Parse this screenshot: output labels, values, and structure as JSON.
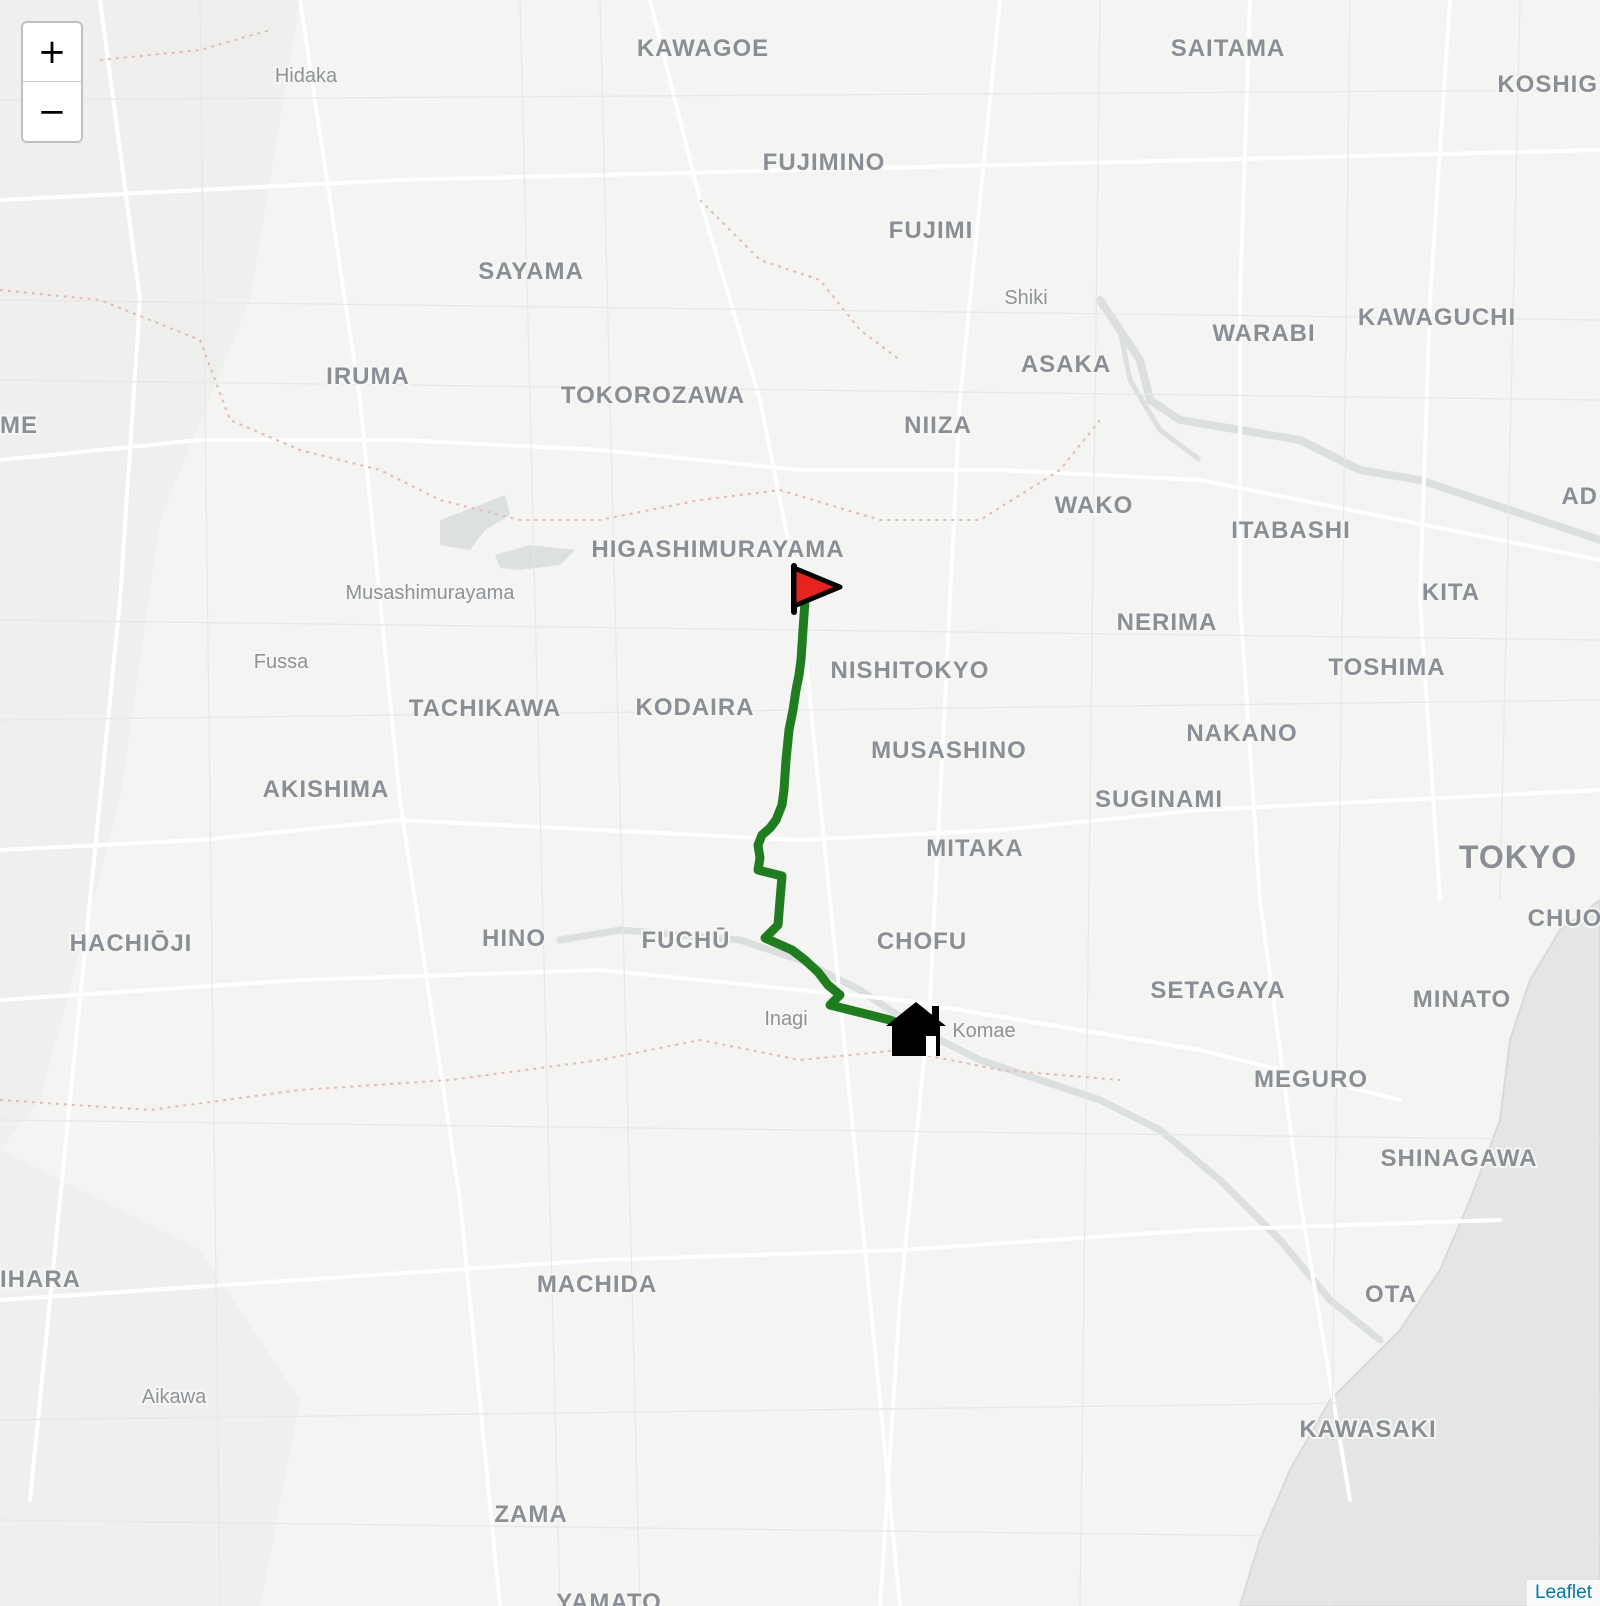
{
  "map": {
    "zoom_in_label": "+",
    "zoom_out_label": "−",
    "attribution": "Leaflet",
    "route_color": "#1f7d1f",
    "start_marker": {
      "icon": "flag-icon",
      "color": "#e8231f"
    },
    "end_marker": {
      "icon": "home-icon",
      "color": "#000000"
    },
    "labels": [
      {
        "text": "KAWAGOE",
        "kind": "city"
      },
      {
        "text": "SAITAMA",
        "kind": "city"
      },
      {
        "text": "KOSHIG",
        "kind": "city"
      },
      {
        "text": "Hidaka",
        "kind": "town"
      },
      {
        "text": "FUJIMINO",
        "kind": "city"
      },
      {
        "text": "FUJIMI",
        "kind": "city"
      },
      {
        "text": "SAYAMA",
        "kind": "city"
      },
      {
        "text": "Shiki",
        "kind": "town"
      },
      {
        "text": "WARABI",
        "kind": "city"
      },
      {
        "text": "KAWAGUCHI",
        "kind": "city"
      },
      {
        "text": "ASAKA",
        "kind": "city"
      },
      {
        "text": "IRUMA",
        "kind": "city"
      },
      {
        "text": "TOKOROZAWA",
        "kind": "city"
      },
      {
        "text": "NIIZA",
        "kind": "city"
      },
      {
        "text": "ME",
        "kind": "city"
      },
      {
        "text": "WAKO",
        "kind": "city"
      },
      {
        "text": "ITABASHI",
        "kind": "city"
      },
      {
        "text": "AD",
        "kind": "city"
      },
      {
        "text": "HIGASHIMURAYAMA",
        "kind": "city"
      },
      {
        "text": "Musashimurayama",
        "kind": "town"
      },
      {
        "text": "KITA",
        "kind": "city"
      },
      {
        "text": "NERIMA",
        "kind": "city"
      },
      {
        "text": "Fussa",
        "kind": "town"
      },
      {
        "text": "NISHITOKYO",
        "kind": "city"
      },
      {
        "text": "TOSHIMA",
        "kind": "city"
      },
      {
        "text": "TACHIKAWA",
        "kind": "city"
      },
      {
        "text": "KODAIRA",
        "kind": "city"
      },
      {
        "text": "NAKANO",
        "kind": "city"
      },
      {
        "text": "MUSASHINO",
        "kind": "city"
      },
      {
        "text": "AKISHIMA",
        "kind": "city"
      },
      {
        "text": "SUGINAMI",
        "kind": "city"
      },
      {
        "text": "MITAKA",
        "kind": "city"
      },
      {
        "text": "TOKYO",
        "kind": "capital"
      },
      {
        "text": "CHUO",
        "kind": "city"
      },
      {
        "text": "HACHIŌJI",
        "kind": "city"
      },
      {
        "text": "HINO",
        "kind": "city"
      },
      {
        "text": "FUCHŪ",
        "kind": "city"
      },
      {
        "text": "CHOFU",
        "kind": "city"
      },
      {
        "text": "SETAGAYA",
        "kind": "city"
      },
      {
        "text": "MINATO",
        "kind": "city"
      },
      {
        "text": "Inagi",
        "kind": "town"
      },
      {
        "text": "Komae",
        "kind": "town"
      },
      {
        "text": "MEGURO",
        "kind": "city"
      },
      {
        "text": "SHINAGAWA",
        "kind": "city"
      },
      {
        "text": "IHARA",
        "kind": "city"
      },
      {
        "text": "MACHIDA",
        "kind": "city"
      },
      {
        "text": "OTA",
        "kind": "city"
      },
      {
        "text": "Aikawa",
        "kind": "town"
      },
      {
        "text": "KAWASAKI",
        "kind": "city"
      },
      {
        "text": "ZAMA",
        "kind": "city"
      },
      {
        "text": "YAMATO",
        "kind": "city"
      }
    ]
  }
}
